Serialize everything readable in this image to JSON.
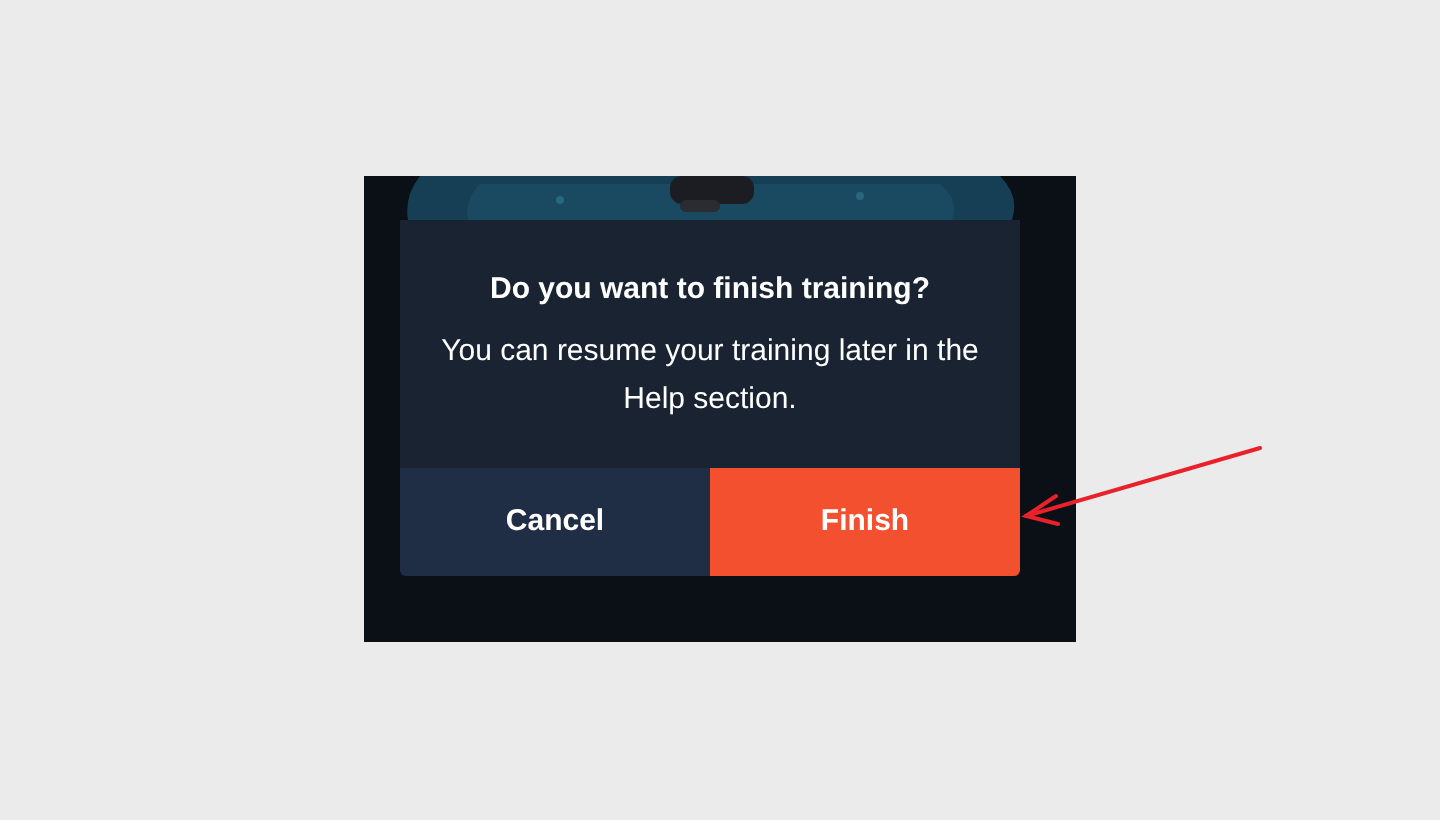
{
  "dialog": {
    "title": "Do you want to finish training?",
    "message": "You can resume your training later in the Help section.",
    "buttons": [
      {
        "label": "Cancel",
        "kind": "secondary"
      },
      {
        "label": "Finish",
        "kind": "primary"
      }
    ]
  },
  "annotation": {
    "kind": "arrow"
  }
}
